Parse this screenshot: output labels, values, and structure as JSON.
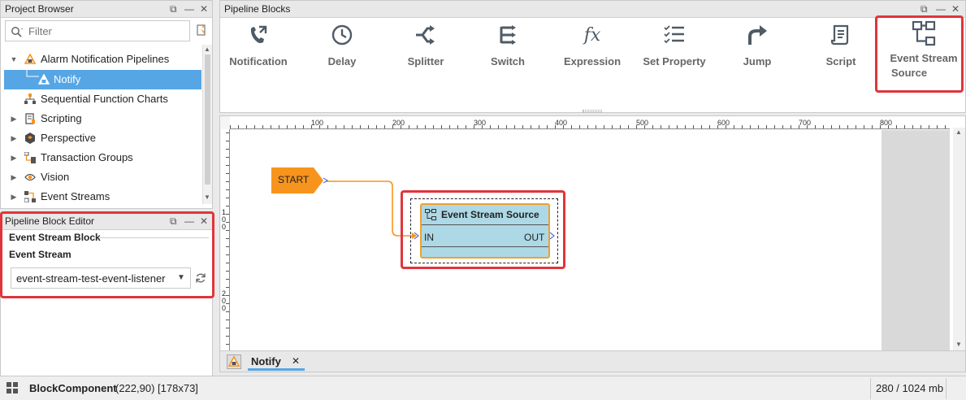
{
  "project_browser": {
    "title": "Project Browser",
    "filter_placeholder": "Filter",
    "items": [
      {
        "label": "Alarm Notification Pipelines"
      },
      {
        "label": "Notify"
      },
      {
        "label": "Sequential Function Charts"
      },
      {
        "label": "Scripting"
      },
      {
        "label": "Perspective"
      },
      {
        "label": "Transaction Groups"
      },
      {
        "label": "Vision"
      },
      {
        "label": "Event Streams"
      }
    ]
  },
  "block_editor": {
    "title": "Pipeline Block Editor",
    "section": "Event Stream Block",
    "field_label": "Event Stream",
    "selected_value": "event-stream-test-event-listener"
  },
  "pipeline_blocks": {
    "title": "Pipeline Blocks",
    "tools": [
      {
        "label": "Notification",
        "icon": "phone-forward-icon"
      },
      {
        "label": "Delay",
        "icon": "clock-icon"
      },
      {
        "label": "Splitter",
        "icon": "splitter-icon"
      },
      {
        "label": "Switch",
        "icon": "switch-icon"
      },
      {
        "label": "Expression",
        "icon": "fx-icon",
        "glyph": "fx"
      },
      {
        "label": "Set Property",
        "icon": "checklist-icon"
      },
      {
        "label": "Jump",
        "icon": "jump-arrow-icon"
      },
      {
        "label": "Script",
        "icon": "script-icon"
      },
      {
        "label": "Event Stream Source",
        "line1": "Event Stream",
        "line2": "Source",
        "icon": "event-stream-icon"
      }
    ]
  },
  "canvas": {
    "ruler_marks": [
      "100",
      "200",
      "300",
      "400",
      "500",
      "600",
      "700",
      "800"
    ],
    "vruler_marks": [
      "1",
      "0",
      "0",
      "2",
      "0",
      "0"
    ],
    "start_label": "START",
    "block": {
      "title": "Event Stream Source",
      "in_label": "IN",
      "out_label": "OUT"
    }
  },
  "tab": {
    "label": "Notify",
    "close": "✕"
  },
  "status": {
    "component": "BlockComponent",
    "coords": "(222,90) [178x73]",
    "memory": "280 / 1024 mb"
  },
  "colors": {
    "accent": "#56a6e6",
    "highlight": "#e0353b",
    "start": "#f7941d",
    "block": "#add8e6"
  }
}
